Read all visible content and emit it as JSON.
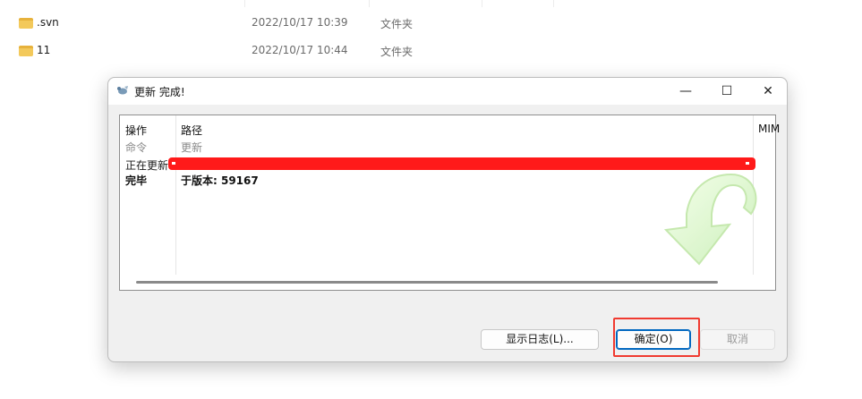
{
  "explorer": {
    "rows": [
      {
        "name": ".svn",
        "date": "2022/10/17 10:39",
        "type": "文件夹"
      },
      {
        "name": "11",
        "date": "2022/10/17 10:44",
        "type": "文件夹"
      }
    ]
  },
  "dialog": {
    "title": "更新 完成!",
    "controls": {
      "minimize": "—",
      "maximize": "☐",
      "close": "✕"
    },
    "columns": {
      "action": "操作",
      "path": "路径",
      "mime": "MIM"
    },
    "rows": [
      {
        "action": "命令",
        "path": "更新"
      },
      {
        "action": "正在更新",
        "path": ""
      },
      {
        "action": "完毕",
        "path": "于版本: 59167"
      }
    ],
    "buttons": {
      "show_log": "显示日志(L)...",
      "ok": "确定(O)",
      "cancel": "取消"
    }
  },
  "colors": {
    "highlight": "#f03a30",
    "redaction": "#ff1a1a",
    "accent": "#0067c0"
  },
  "icons": {
    "folder": "folder-icon",
    "app": "tortoisesvn-icon",
    "watermark": "update-arrow-icon"
  }
}
